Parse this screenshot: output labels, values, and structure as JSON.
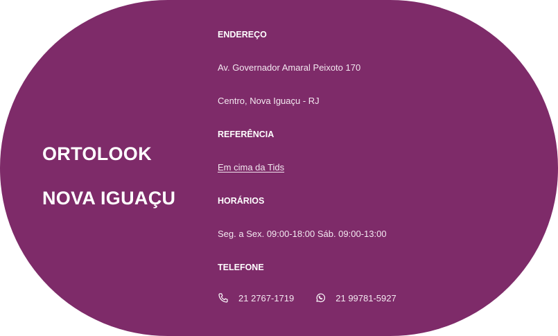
{
  "store": {
    "line1": "ORTOLOOK",
    "line2": "NOVA IGUAÇU"
  },
  "address": {
    "label": "ENDEREÇO",
    "line1": "Av. Governador Amaral Peixoto 170",
    "line2": "Centro, Nova Iguaçu - RJ"
  },
  "reference": {
    "label": "REFERÊNCIA",
    "value": "Em cima da Tids"
  },
  "hours": {
    "label": "HORÁRIOS",
    "value": "Seg. a Sex. 09:00-18:00 Sáb. 09:00-13:00"
  },
  "phone": {
    "label": "TELEFONE",
    "landline": "21 2767-1719",
    "whatsapp": "21 99781-5927",
    "landline_icon": "phone-icon",
    "whatsapp_icon": "whatsapp-icon"
  },
  "colors": {
    "background": "#7e2b69",
    "text": "#ffffff"
  }
}
